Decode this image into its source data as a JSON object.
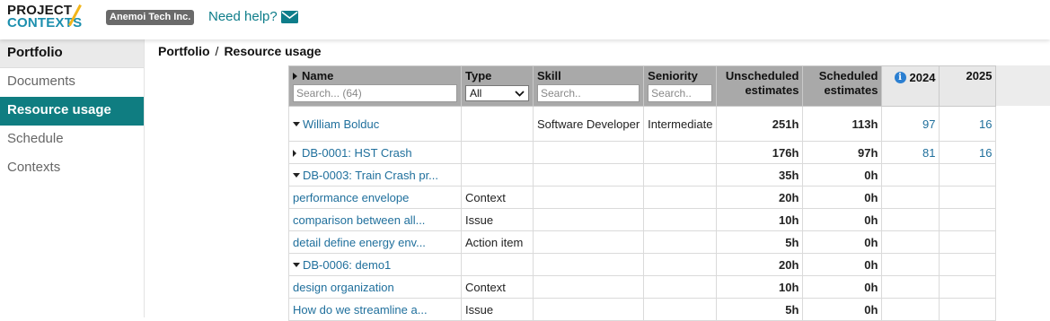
{
  "brand": {
    "line1": "PROJECT",
    "line2": "CONTEXTS"
  },
  "tenant": "Anemoi Tech Inc.",
  "help": "Need help?",
  "nav": [
    {
      "label": "Portfolio",
      "state": "section"
    },
    {
      "label": "Documents",
      "state": "normal"
    },
    {
      "label": "Resource usage",
      "state": "active"
    },
    {
      "label": "Schedule",
      "state": "normal"
    },
    {
      "label": "Contexts",
      "state": "normal"
    }
  ],
  "breadcrumb": {
    "parent": "Portfolio",
    "separator": "/",
    "current": "Resource usage"
  },
  "table": {
    "headers": {
      "name": "Name",
      "type": "Type",
      "skill": "Skill",
      "seniority": "Seniority",
      "unscheduled_1": "Unscheduled",
      "unscheduled_2": "estimates",
      "scheduled_1": "Scheduled",
      "scheduled_2": "estimates",
      "year1": "2024",
      "year2": "2025"
    },
    "filters": {
      "name_placeholder": "Search... (64)",
      "type_value": "All",
      "skill_placeholder": "Search..",
      "seniority_placeholder": "Search.."
    },
    "rows": [
      {
        "name": "William Bolduc",
        "type": "",
        "skill": "Software Developer",
        "seniority": "Intermediate",
        "unscheduled": "251h",
        "scheduled": "113h",
        "y2024": "97",
        "y2025": "16"
      },
      {
        "name": "DB-0001: HST Crash",
        "type": "",
        "skill": "",
        "seniority": "",
        "unscheduled": "176h",
        "scheduled": "97h",
        "y2024": "81",
        "y2025": "16"
      },
      {
        "name": "DB-0003: Train Crash pr...",
        "type": "",
        "skill": "",
        "seniority": "",
        "unscheduled": "35h",
        "scheduled": "0h",
        "y2024": "",
        "y2025": ""
      },
      {
        "name": "performance envelope",
        "type": "Context",
        "skill": "",
        "seniority": "",
        "unscheduled": "20h",
        "scheduled": "0h",
        "y2024": "",
        "y2025": ""
      },
      {
        "name": "comparison between all...",
        "type": "Issue",
        "skill": "",
        "seniority": "",
        "unscheduled": "10h",
        "scheduled": "0h",
        "y2024": "",
        "y2025": ""
      },
      {
        "name": "detail define energy env...",
        "type": "Action item",
        "skill": "",
        "seniority": "",
        "unscheduled": "5h",
        "scheduled": "0h",
        "y2024": "",
        "y2025": ""
      },
      {
        "name": "DB-0006: demo1",
        "type": "",
        "skill": "",
        "seniority": "",
        "unscheduled": "20h",
        "scheduled": "0h",
        "y2024": "",
        "y2025": ""
      },
      {
        "name": "design organization",
        "type": "Context",
        "skill": "",
        "seniority": "",
        "unscheduled": "10h",
        "scheduled": "0h",
        "y2024": "",
        "y2025": ""
      },
      {
        "name": "How do we streamline a...",
        "type": "Issue",
        "skill": "",
        "seniority": "",
        "unscheduled": "5h",
        "scheduled": "0h",
        "y2024": "",
        "y2025": ""
      }
    ]
  },
  "icons": {
    "help": "envelope-icon",
    "year_info": "info-icon"
  },
  "colors": {
    "accent": "#0f7d81",
    "link": "#1f6f9c",
    "header_bg": "#a9a9a9",
    "badge_bg": "#6a6a6a"
  }
}
